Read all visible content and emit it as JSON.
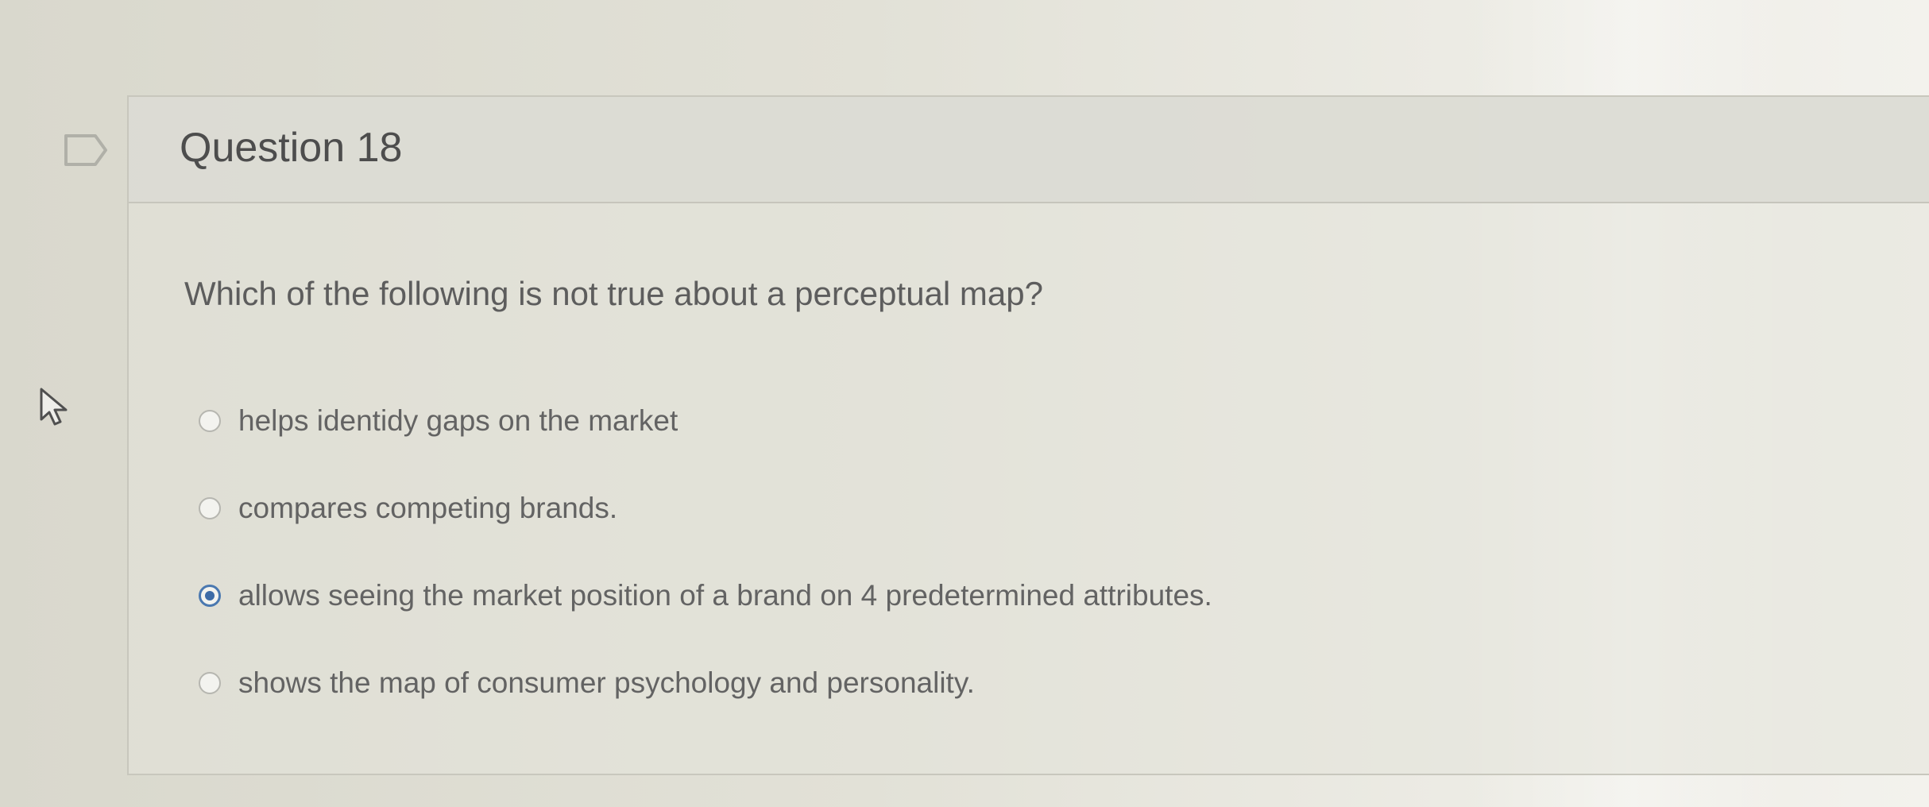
{
  "question": {
    "title": "Question 18",
    "text": "Which of the following is not true about a perceptual map?",
    "selected_index": 2,
    "answers": [
      {
        "label": "helps identidy gaps on the market",
        "selected": false
      },
      {
        "label": "compares competing brands.",
        "selected": false
      },
      {
        "label": "allows seeing the market position of a brand on 4 predetermined attributes.",
        "selected": true
      },
      {
        "label": "shows the map of consumer psychology and personality.",
        "selected": false
      }
    ]
  },
  "icons": {
    "flag": "flag-icon",
    "cursor": "mouse-pointer-icon"
  },
  "colors": {
    "selected_radio": "#3d6ba6",
    "text": "#5d5d5d"
  }
}
